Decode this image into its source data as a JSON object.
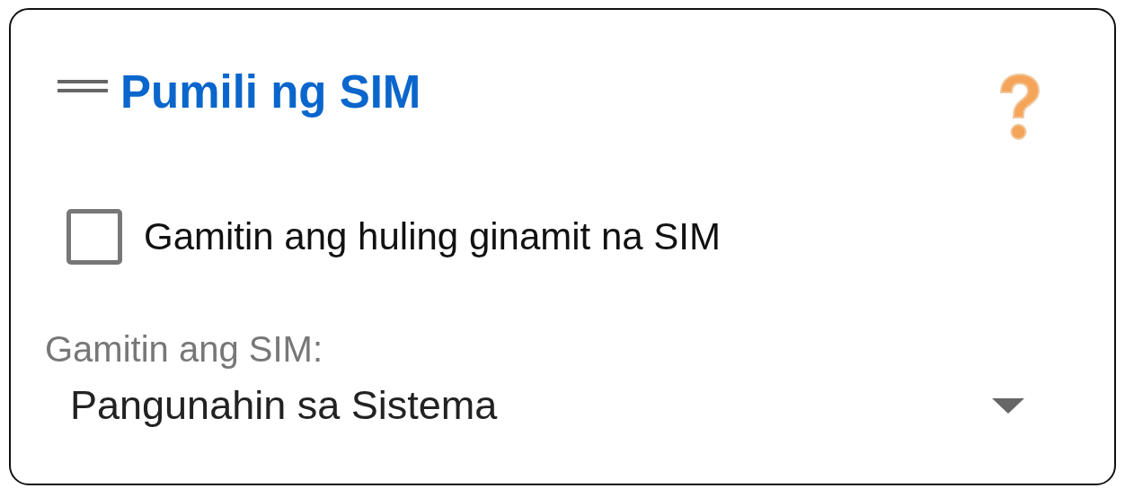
{
  "dialog": {
    "title": "Pumili ng SIM"
  },
  "remember_option": {
    "label": "Gamitin ang huling ginamit na SIM",
    "checked": false
  },
  "sim_select": {
    "label": "Gamitin ang SIM:",
    "value": "Pangunahin sa Sistema"
  }
}
